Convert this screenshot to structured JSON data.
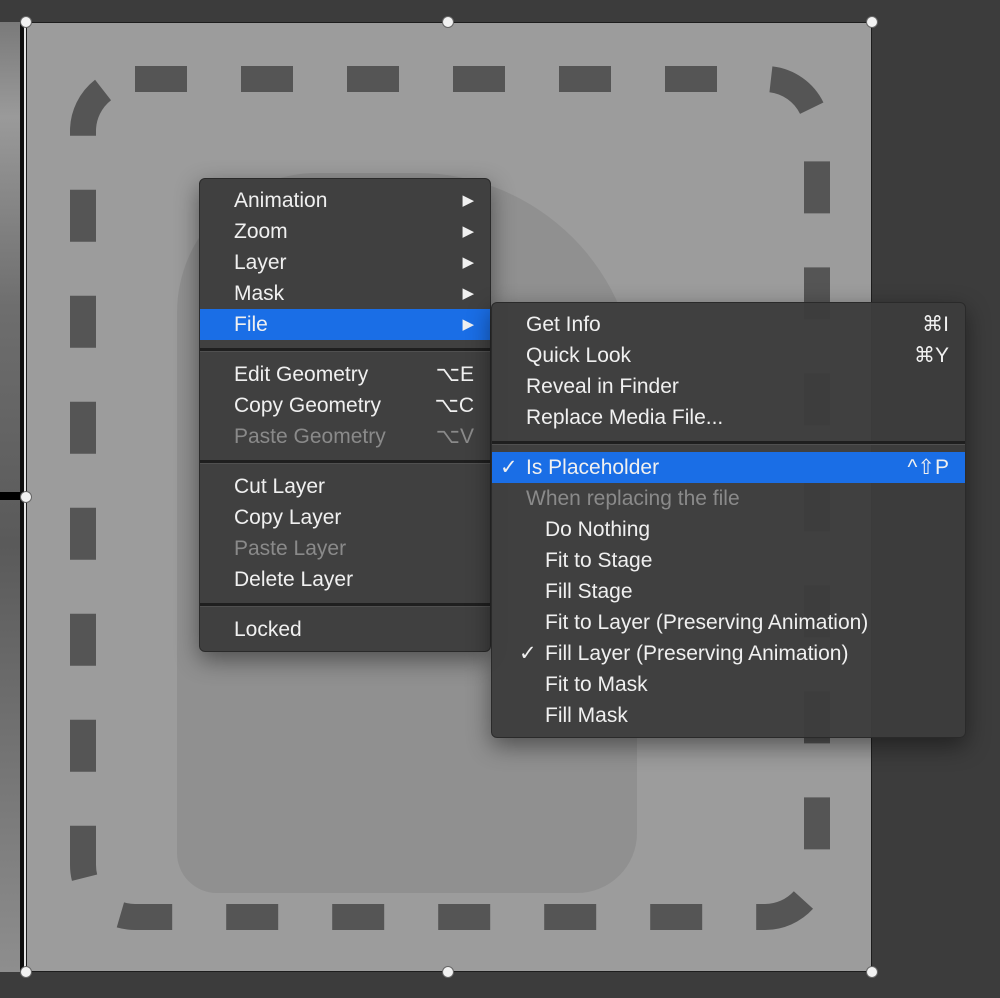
{
  "context_menu": {
    "items": [
      {
        "label": "Animation",
        "has_submenu": true
      },
      {
        "label": "Zoom",
        "has_submenu": true
      },
      {
        "label": "Layer",
        "has_submenu": true
      },
      {
        "label": "Mask",
        "has_submenu": true
      },
      {
        "label": "File",
        "has_submenu": true,
        "selected": true
      }
    ],
    "geometry_group": [
      {
        "label": "Edit Geometry",
        "shortcut": "⌥E",
        "enabled": true
      },
      {
        "label": "Copy Geometry",
        "shortcut": "⌥C",
        "enabled": true
      },
      {
        "label": "Paste Geometry",
        "shortcut": "⌥V",
        "enabled": false
      }
    ],
    "layer_group": [
      {
        "label": "Cut Layer",
        "enabled": true
      },
      {
        "label": "Copy Layer",
        "enabled": true
      },
      {
        "label": "Paste Layer",
        "enabled": false
      },
      {
        "label": "Delete Layer",
        "enabled": true
      }
    ],
    "locked_label": "Locked"
  },
  "file_submenu": {
    "top_group": [
      {
        "label": "Get Info",
        "shortcut": "⌘I"
      },
      {
        "label": "Quick Look",
        "shortcut": "⌘Y"
      },
      {
        "label": "Reveal in Finder",
        "shortcut": ""
      },
      {
        "label": "Replace Media File...",
        "shortcut": ""
      }
    ],
    "placeholder": {
      "label": "Is Placeholder",
      "shortcut": "^⇧P",
      "checked": true
    },
    "replace_header": "When replacing the file",
    "replace_options": [
      {
        "label": "Do Nothing",
        "checked": false
      },
      {
        "label": "Fit to Stage",
        "checked": false
      },
      {
        "label": "Fill Stage",
        "checked": false
      },
      {
        "label": "Fit to Layer (Preserving Animation)",
        "checked": false
      },
      {
        "label": "Fill Layer (Preserving Animation)",
        "checked": true
      },
      {
        "label": "Fit to Mask",
        "checked": false
      },
      {
        "label": "Fill Mask",
        "checked": false
      }
    ],
    "check_glyph": "✓"
  },
  "glyphs": {
    "submenu_arrow": "▶"
  },
  "colors": {
    "selection": "#1a6ee6",
    "menu_bg": "#3c3c3c"
  }
}
